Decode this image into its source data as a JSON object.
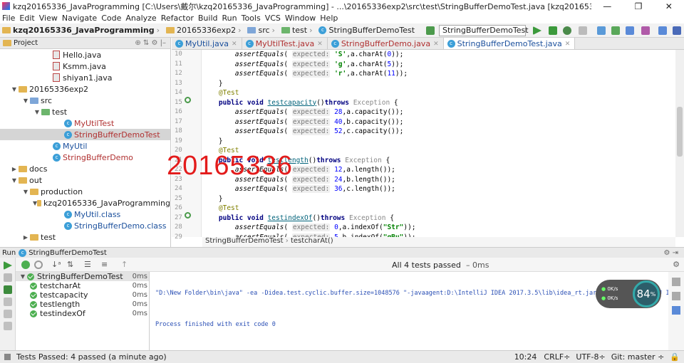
{
  "window": {
    "title": "kzq20165336_JavaProgramming [C:\\Users\\戴尔\\kzq20165336_JavaProgramming] - ...\\20165336exp2\\src\\test\\StringBufferDemoTest.java [kzq20165336_JavaProgramming] - IntelliJ IDEA",
    "controls": [
      "—",
      "❐",
      "✕"
    ]
  },
  "menu": [
    "File",
    "Edit",
    "View",
    "Navigate",
    "Code",
    "Analyze",
    "Refactor",
    "Build",
    "Run",
    "Tools",
    "VCS",
    "Window",
    "Help"
  ],
  "navbar": {
    "crumbs": [
      "kzq20165336_JavaProgramming",
      "20165336exp2",
      "src",
      "test",
      "StringBufferDemoTest"
    ],
    "run_config": "StringBufferDemoTest"
  },
  "sidebar": {
    "header": "Project",
    "items": [
      {
        "label": "Hello.java",
        "indent": 4,
        "kind": "java"
      },
      {
        "label": "Ksmm.java",
        "indent": 4,
        "kind": "java"
      },
      {
        "label": "shiyan1.java",
        "indent": 4,
        "kind": "java"
      },
      {
        "label": "20165336exp2",
        "indent": 1,
        "kind": "folder",
        "arrow": "▼"
      },
      {
        "label": "src",
        "indent": 2,
        "kind": "folder-blue",
        "arrow": "▼"
      },
      {
        "label": "test",
        "indent": 3,
        "kind": "folder-green",
        "arrow": "▼"
      },
      {
        "label": "MyUtilTest",
        "indent": 5,
        "kind": "class",
        "color": "#b03030"
      },
      {
        "label": "StringBufferDemoTest",
        "indent": 5,
        "kind": "class",
        "color": "#b03030",
        "selected": true
      },
      {
        "label": "MyUtil",
        "indent": 4,
        "kind": "class",
        "color": "#1a4f9c"
      },
      {
        "label": "StringBufferDemo",
        "indent": 4,
        "kind": "class",
        "color": "#b03030"
      },
      {
        "label": "docs",
        "indent": 1,
        "kind": "folder",
        "arrow": "▶"
      },
      {
        "label": "out",
        "indent": 1,
        "kind": "folder",
        "arrow": "▼"
      },
      {
        "label": "production",
        "indent": 2,
        "kind": "folder",
        "arrow": "▼"
      },
      {
        "label": "kzq20165336_JavaProgramming",
        "indent": 3,
        "kind": "folder",
        "arrow": "▼"
      },
      {
        "label": "MyUtil.class",
        "indent": 5,
        "kind": "class",
        "color": "#1a4f9c"
      },
      {
        "label": "StringBufferDemo.class",
        "indent": 5,
        "kind": "class",
        "color": "#1a4f9c"
      },
      {
        "label": "test",
        "indent": 2,
        "kind": "folder",
        "arrow": "▶"
      }
    ]
  },
  "tabs": [
    {
      "label": "MyUtil.java",
      "active": false
    },
    {
      "label": "MyUtilTest.java",
      "active": false
    },
    {
      "label": "StringBufferDemo.java",
      "active": false
    },
    {
      "label": "StringBufferDemoTest.java",
      "active": true
    }
  ],
  "gutter": [
    "10",
    "11",
    "12",
    "13",
    "14",
    "15",
    "16",
    "17",
    "18",
    "19",
    "20",
    "21",
    "22",
    "23",
    "24",
    "25",
    "26",
    "27",
    "28",
    "29"
  ],
  "editor_breadcrumb": [
    "StringBufferDemoTest",
    "testcharAt()"
  ],
  "watermark": "20165336",
  "run": {
    "tab_label": "Run",
    "config_label": "StringBufferDemoTest",
    "status": "All 4 tests passed",
    "status_time": "– 0ms",
    "suite": {
      "name": "StringBufferDemoTest",
      "time": "0ms"
    },
    "tests": [
      {
        "name": "testcharAt",
        "time": "0ms"
      },
      {
        "name": "testcapacity",
        "time": "0ms"
      },
      {
        "name": "testlength",
        "time": "0ms"
      },
      {
        "name": "testindexOf",
        "time": "0ms"
      }
    ],
    "console_line1": "\"D:\\New Folder\\bin\\java\" -ea -Didea.test.cyclic.buffer.size=1048576 \"-javaagent:D:\\IntelliJ IDEA 2017.3.5\\lib\\idea_rt.jar=57112:D:\\IntelliJ IDEA 2017.3.5\\bin\" -",
    "console_line2": "Process finished with exit code 0"
  },
  "gauge": {
    "up": "0K/s",
    "down": "0K/s",
    "value": "84",
    "unit": "%"
  },
  "statusbar": {
    "left": "Tests Passed: 4 passed (a minute ago)",
    "position": "10:24",
    "line_sep": "CRLF÷",
    "encoding": "UTF-8÷",
    "vcs": "Git: master ÷"
  }
}
